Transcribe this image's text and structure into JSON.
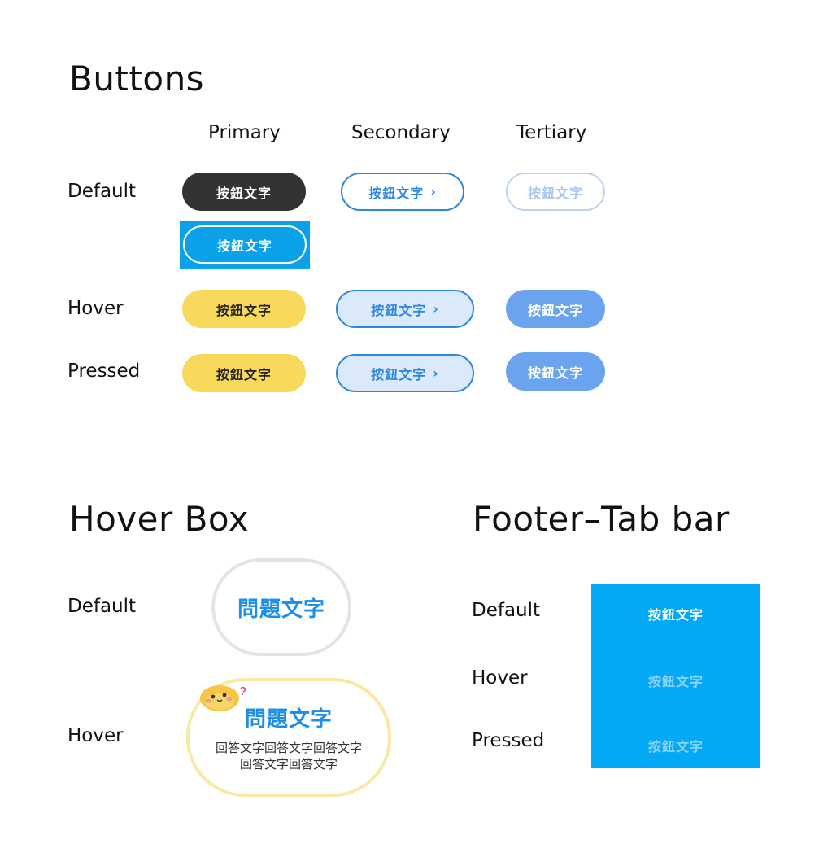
{
  "buttons_section": {
    "title": "Buttons",
    "columns": [
      "Primary",
      "Secondary",
      "Tertiary"
    ],
    "rows": [
      "Default",
      "Hover",
      "Pressed"
    ],
    "button_label": "按鈕文字",
    "chevron": "›"
  },
  "hover_box_section": {
    "title": "Hover Box",
    "rows": [
      "Default",
      "Hover"
    ],
    "question": "問題文字",
    "answer_line1": "回答文字回答文字回答文字",
    "answer_line2": "回答文字回答文字",
    "mascot_icon": "bird-mascot-icon"
  },
  "footer_tab_section": {
    "title": "Footer–Tab bar",
    "rows": [
      "Default",
      "Hover",
      "Pressed"
    ],
    "tab_label": "按鈕文字"
  },
  "colors": {
    "primary_default": "#333333",
    "primary_hover": "#f8d95c",
    "primary_focus": "#0aa1e8",
    "secondary_border": "#2e86de",
    "secondary_tint": "#dbeafa",
    "tertiary_filled": "#6aa3ee",
    "tabbar_bg": "#03a9f4",
    "question_blue": "#1d8fe6"
  }
}
